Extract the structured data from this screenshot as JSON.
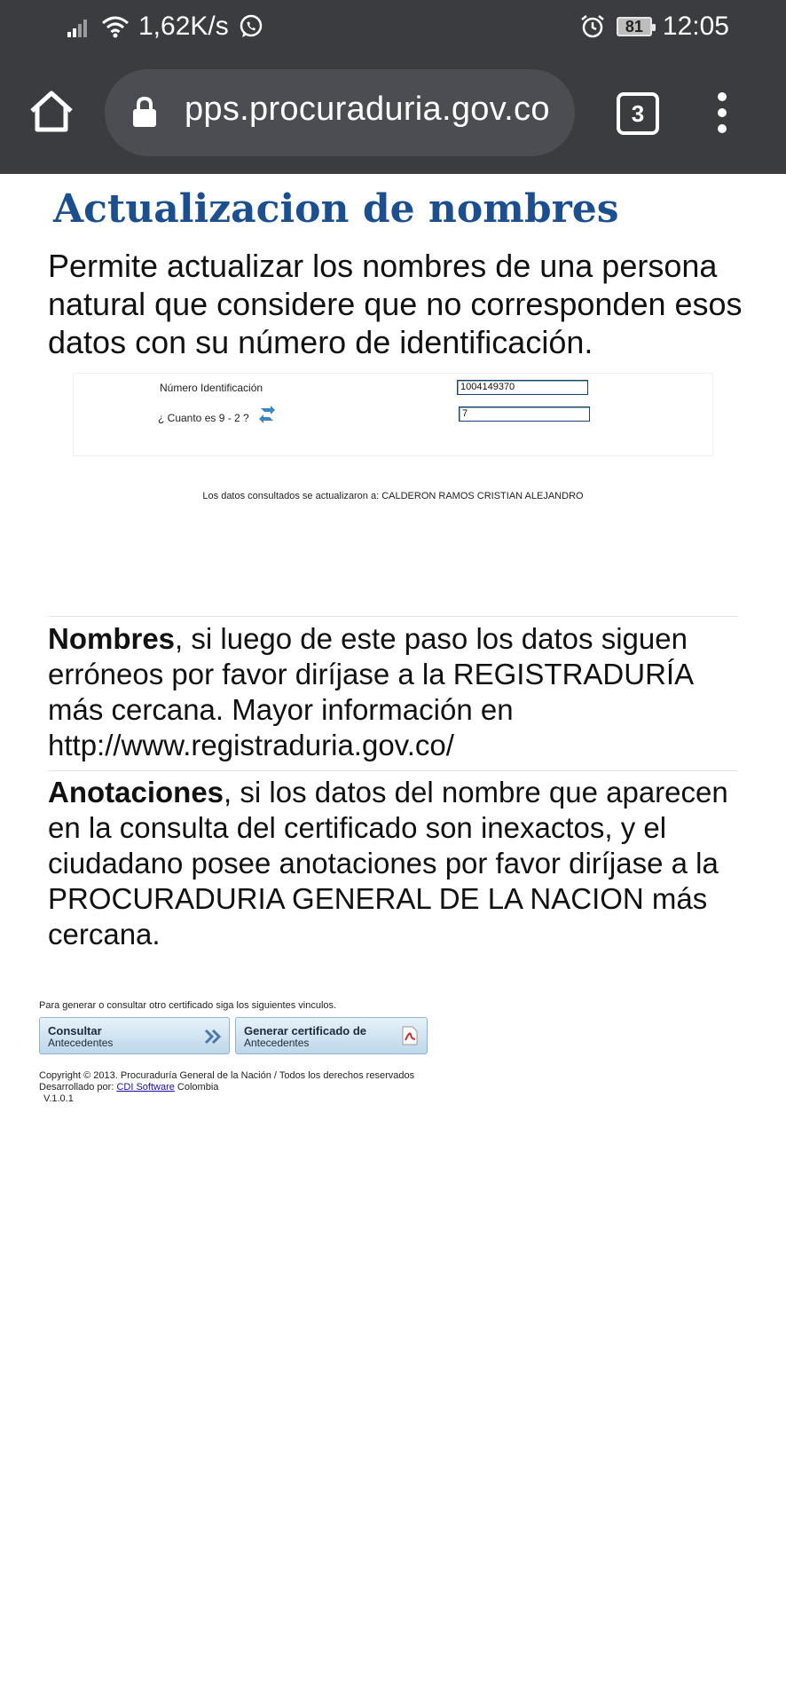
{
  "status_bar": {
    "network_speed": "1,62K/s",
    "battery": "81",
    "time": "12:05"
  },
  "browser": {
    "url": "pps.procuraduria.gov.co",
    "tab_count": "3"
  },
  "page": {
    "title": "Actualizacion de nombres",
    "intro": "Permite actualizar los nombres de una persona natural que considere que no corresponden esos datos con su número de identificación.",
    "form": {
      "id_label": "Número Identificación",
      "id_value": "1004149370",
      "captcha_label": "¿ Cuanto es 9 - 2 ?",
      "captcha_value": "7"
    },
    "result_message": "Los datos consultados se actualizaron a: CALDERON RAMOS CRISTIAN ALEJANDRO",
    "nombres_title": "Nombres",
    "nombres_text": ", si luego de este paso los datos siguen erróneos por favor diríjase a la REGISTRADURÍA más cercana. Mayor información en http://www.registraduria.gov.co/",
    "anotaciones_title": "Anotaciones",
    "anotaciones_text": ", si los datos del nombre que aparecen en la consulta del certificado son inexactos, y el ciudadano posee anotaciones por favor diríjase a la PROCURADURIA GENERAL DE LA NACION más cercana.",
    "links_hint": "Para generar o consultar otro certificado siga los siguientes vinculos.",
    "btn_consultar_line1": "Consultar",
    "btn_consultar_line2": "Antecedentes",
    "btn_generar_line1": "Generar certificado de",
    "btn_generar_line2": "Antecedentes",
    "footer_copyright": "Copyright © 2013. Procuraduría General de la Nación / Todos los derechos reservados",
    "footer_dev_prefix": "Desarrollado por: ",
    "footer_dev_link": "CDI Software",
    "footer_dev_suffix": " Colombia",
    "footer_version": "V.1.0.1"
  }
}
